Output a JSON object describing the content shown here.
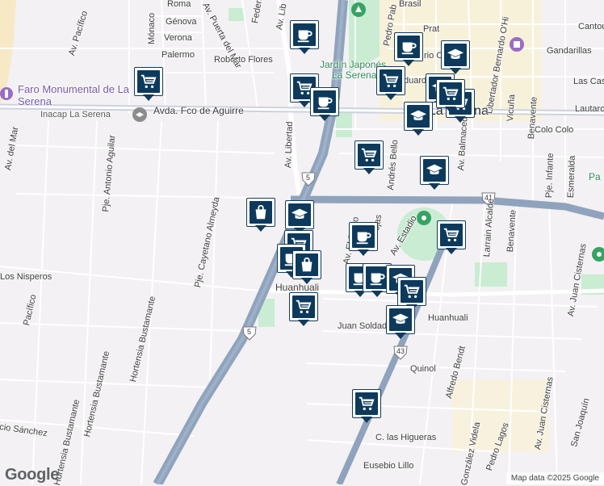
{
  "map": {
    "labels": {
      "roma": "Roma",
      "monaco": "Mónaco",
      "genova": "Génova",
      "verona": "Verona",
      "palermo": "Palermo",
      "roberto_flores": "Roberto Flores",
      "puerta_del_mar": "Av. Puerta del Mar",
      "federico": "Federico",
      "av_libertad_top": "Av. Lib",
      "av_pacifico": "Av. Pacífico",
      "av_del_mar": "Av. del Mar",
      "faro": "Faro Monumental de La Serena",
      "inacap": "Inacap La Serena",
      "avda_aguirre": "Avda. Fco de Aguirre",
      "av_libertad": "Av. Libertad",
      "pje_antonio_aguilar": "Pje. Antonio Aguilar",
      "pje_cayetano": "Pje. Cayetano Almeyda",
      "los_nisperos": "Los Nisperos",
      "pacifico": "Pacífico",
      "hortensia_1": "Hortensia Bustamante",
      "hortensia_2": "Hortensia Bustamante",
      "hortensia_3": "Hortensia Bustamante",
      "sanchez": "cio Sánchez",
      "huanhuali": "Huanhuali",
      "huanhuali_2": "Huanhuali",
      "juan_soldado": "Juan Soldado",
      "quinol": "Quinol",
      "alfredo_bendt": "Alfredo Bendt",
      "c_las_higueras": "C. las Higueras",
      "eusebio_lillo": "Eusebio Lillo",
      "gonzalez_videla": "González Videla",
      "pedro_lagos": "Pedro Lagos",
      "av_juan_cisternas": "Av. Juan Cisternas",
      "av_juan_cisternas_2": "Av. Juan Cisternas",
      "san_joaquin": "San Joaquín",
      "av_estadio": "Av. Estadio",
      "av_el_santo": "Av. El Santo",
      "andres_bello": "Andrés Bello",
      "ojas": "ojas",
      "av_balmaceda": "Av. Balmaceda",
      "larrain_alcalde": "Larrain Alcalde",
      "benavente": "Benavente",
      "benavente_2": "Benavente",
      "pje_infante": "Pje. Infante",
      "esmeralda": "Esmeralda",
      "colo_colo": "Colo Colo",
      "lautaro": "Lautaro",
      "las_casas": "Las Cas",
      "gandarillas": "Gandarillas",
      "cantou": "Cantou",
      "brasil": "Brasil",
      "prat": "Prat",
      "pedro_pab": "Pedro Pab",
      "jardin_japones": "Jardín Japonés",
      "la_serena_park": "La Serena",
      "la_serena_city": "La Serena",
      "libertador": "Libertador Bernardo O'Hi",
      "vicuna": "Vicuña",
      "eduardo": "duardo",
      "rio_c": "rio C",
      "pa": "Pa",
      "route_5": "5",
      "route_5b": "5",
      "route_41": "41",
      "route_43": "43"
    },
    "markers": [
      {
        "type": "shopping-cart",
        "name": "cart-marker-1"
      },
      {
        "type": "coffee-cup",
        "name": "coffee-marker-1"
      },
      {
        "type": "shopping-cart",
        "name": "cart-marker-2"
      },
      {
        "type": "coffee-cup",
        "name": "coffee-marker-2"
      },
      {
        "type": "coffee-cup",
        "name": "coffee-marker-3"
      },
      {
        "type": "shopping-cart",
        "name": "cart-marker-3"
      },
      {
        "type": "graduation-cap",
        "name": "school-marker-1"
      },
      {
        "type": "graduation-cap",
        "name": "school-marker-2"
      },
      {
        "type": "shopping-cart",
        "name": "cart-marker-4"
      },
      {
        "type": "graduation-cap",
        "name": "school-marker-3"
      },
      {
        "type": "shopping-cart",
        "name": "cart-marker-5"
      },
      {
        "type": "shopping-cart",
        "name": "cart-marker-6"
      },
      {
        "type": "graduation-cap",
        "name": "school-marker-4"
      },
      {
        "type": "shopping-bag",
        "name": "store-marker-1"
      },
      {
        "type": "graduation-cap",
        "name": "school-marker-5"
      },
      {
        "type": "shopping-cart",
        "name": "cart-marker-7"
      },
      {
        "type": "coffee-cup",
        "name": "coffee-marker-4"
      },
      {
        "type": "shopping-bag",
        "name": "store-marker-2"
      },
      {
        "type": "coffee-cup",
        "name": "coffee-marker-5"
      },
      {
        "type": "shopping-cart",
        "name": "cart-marker-8"
      },
      {
        "type": "coffee-cup",
        "name": "coffee-marker-6"
      },
      {
        "type": "coffee-cup",
        "name": "coffee-marker-7"
      },
      {
        "type": "graduation-cap",
        "name": "school-marker-6"
      },
      {
        "type": "shopping-cart",
        "name": "cart-marker-9"
      },
      {
        "type": "shopping-cart",
        "name": "cart-marker-10"
      },
      {
        "type": "graduation-cap",
        "name": "school-marker-7"
      },
      {
        "type": "shopping-cart",
        "name": "cart-marker-11"
      }
    ],
    "colors": {
      "marker": "#0d3a5c",
      "highway": "#8fa3bd",
      "park": "#c9ecd3",
      "land": "#f3f1f3",
      "sea": "#f5e8c6",
      "poi": "#7a5aa8",
      "commercial": "#fcf2c9"
    }
  },
  "footer": {
    "logo": "Google",
    "credit": "Map data ©2025 Google"
  }
}
